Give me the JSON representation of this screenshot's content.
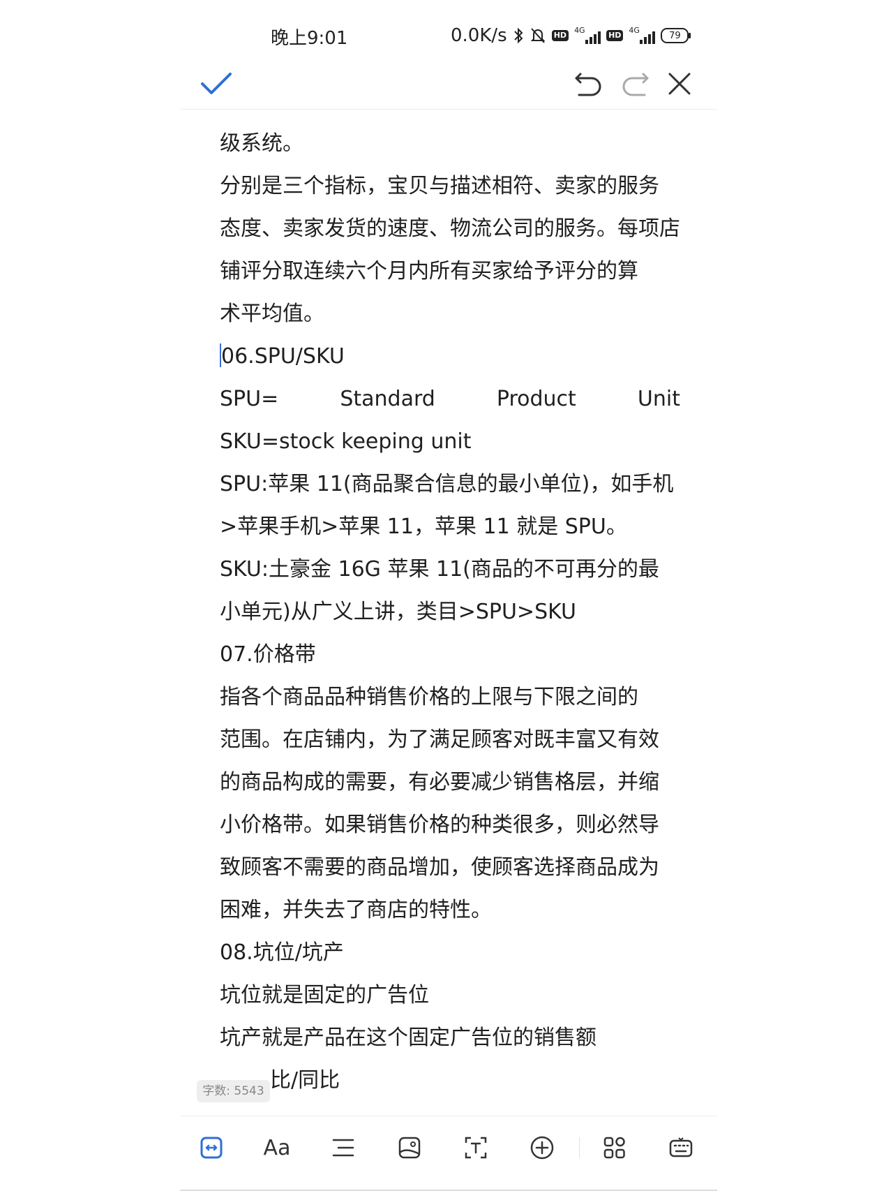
{
  "status_bar": {
    "time": "晚上9:01",
    "speed": "0.0K/s",
    "network1": "4G",
    "network2": "4G",
    "hd": "HD",
    "battery": "79"
  },
  "toolbar": {
    "confirm_icon": "checkmark-icon",
    "undo_icon": "undo-icon",
    "redo_icon": "redo-icon",
    "close_icon": "close-icon"
  },
  "document": {
    "lines": [
      "级系统。",
      "分别是三个指标，宝贝与描述相符、卖家的服务",
      "态度、卖家发货的速度、物流公司的服务。每项店",
      "铺评分取连续六个月内所有买家给予评分的算",
      "术平均值。",
      "06.SPU/SKU",
      "SKU=stock keeping unit",
      "SPU:苹果 11(商品聚合信息的最小单位)，如手机",
      ">苹果手机>苹果 11，苹果 11 就是 SPU。",
      "SKU:土豪金 16G 苹果 11(商品的不可再分的最",
      "小单元)从广义上讲，类目>SPU>SKU",
      "07.价格带",
      "指各个商品品种销售价格的上限与下限之间的",
      "范围。在店铺内，为了满足顾客对既丰富又有效",
      "的商品构成的需要，有必要减少销售格层，并缩",
      "小价格带。如果销售价格的种类很多，则必然导",
      "致顾客不需要的商品增加，使顾客选择商品成为",
      "困难，并失去了商店的特性。",
      "08.坑位/坑产",
      "坑位就是固定的广告位",
      "坑产就是产品在这个固定广告位的销售额",
      "比/同比"
    ],
    "spu_line": [
      "SPU=",
      "Standard",
      "Product",
      "Unit"
    ]
  },
  "word_count": "字数: 5543",
  "bottom_toolbar": {
    "icons": [
      "text-select-icon",
      "font-style-icon",
      "paragraph-align-icon",
      "insert-image-icon",
      "text-recognition-icon",
      "add-icon",
      "apps-grid-icon",
      "keyboard-icon"
    ],
    "font_label": "Aa"
  },
  "colors": {
    "accent": "#2f6fd6",
    "text": "#1f1f1f",
    "muted": "#888888"
  }
}
